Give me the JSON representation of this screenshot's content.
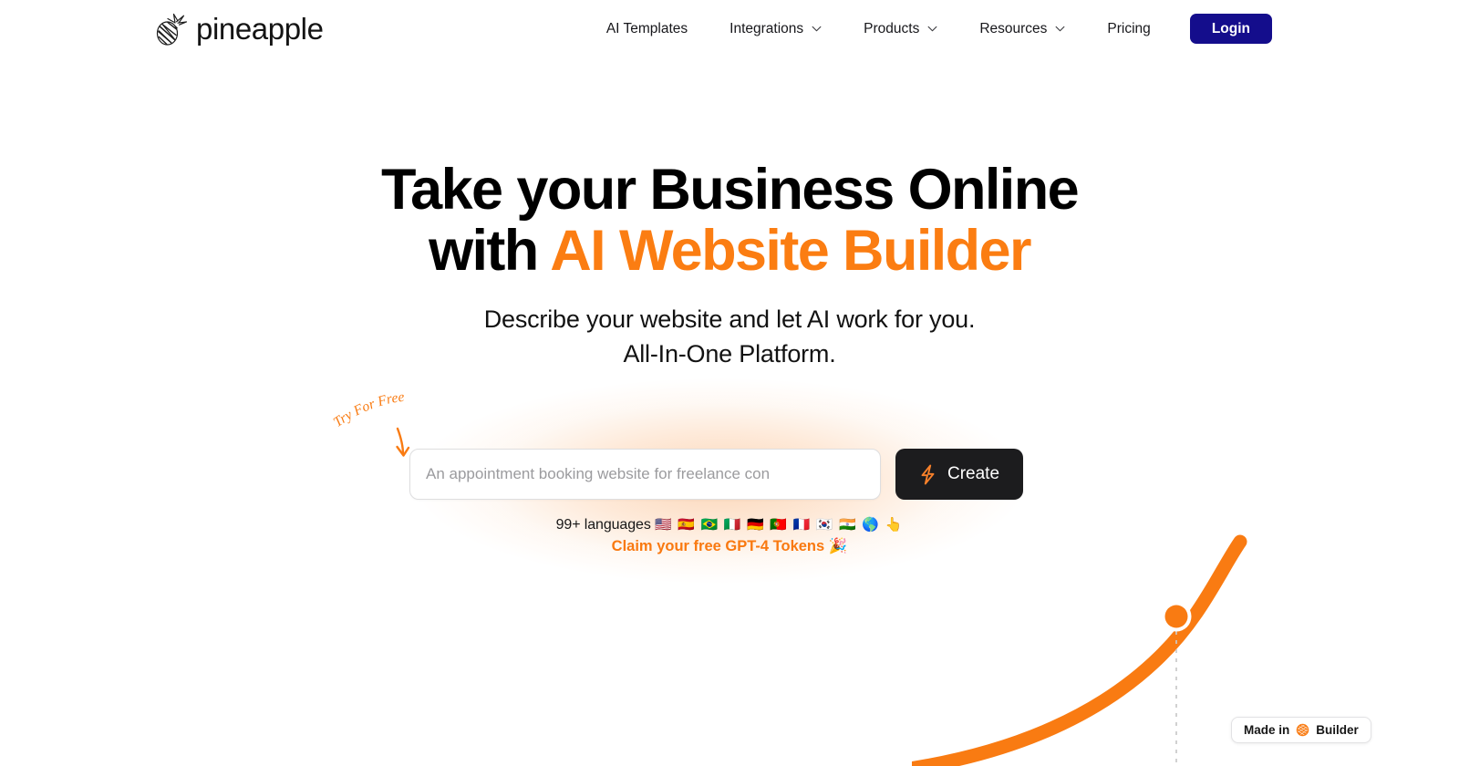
{
  "header": {
    "logo": {
      "text": "pineapple",
      "icon": "pineapple-icon"
    },
    "nav": [
      {
        "label": "AI Templates",
        "has_dropdown": false
      },
      {
        "label": "Integrations",
        "has_dropdown": true
      },
      {
        "label": "Products",
        "has_dropdown": true
      },
      {
        "label": "Resources",
        "has_dropdown": true
      },
      {
        "label": "Pricing",
        "has_dropdown": false
      }
    ],
    "login_label": "Login"
  },
  "hero": {
    "headline_line1": "Take your Business Online",
    "headline_line2_prefix": "with ",
    "headline_line2_accent": "AI Website Builder",
    "subhead_line1": "Describe your website and let AI work for you.",
    "subhead_line2": "All-In-One Platform.",
    "annotation": "Try For Free"
  },
  "search": {
    "placeholder": "An appointment booking website for freelance con",
    "value": "",
    "create_label": "Create",
    "create_icon": "lightning-bolt-icon"
  },
  "languages": {
    "text": "99+ languages ",
    "flags": "🇺🇸 🇪🇸 🇧🇷 🇮🇹 🇩🇪 🇵🇹 🇫🇷 🇰🇷 🇮🇳 🌎 👆",
    "claim_text": "Claim your free GPT-4 Tokens 🎉"
  },
  "badge": {
    "prefix": "Made in",
    "suffix": "Builder",
    "icon": "pineapple-badge-icon"
  },
  "colors": {
    "accent_orange": "#fb7d12",
    "curve_orange": "#f97b12",
    "login_navy": "#140d8c",
    "create_dark": "#1c1c1e",
    "text_black": "#000000",
    "placeholder_gray": "#9b9b9e"
  }
}
